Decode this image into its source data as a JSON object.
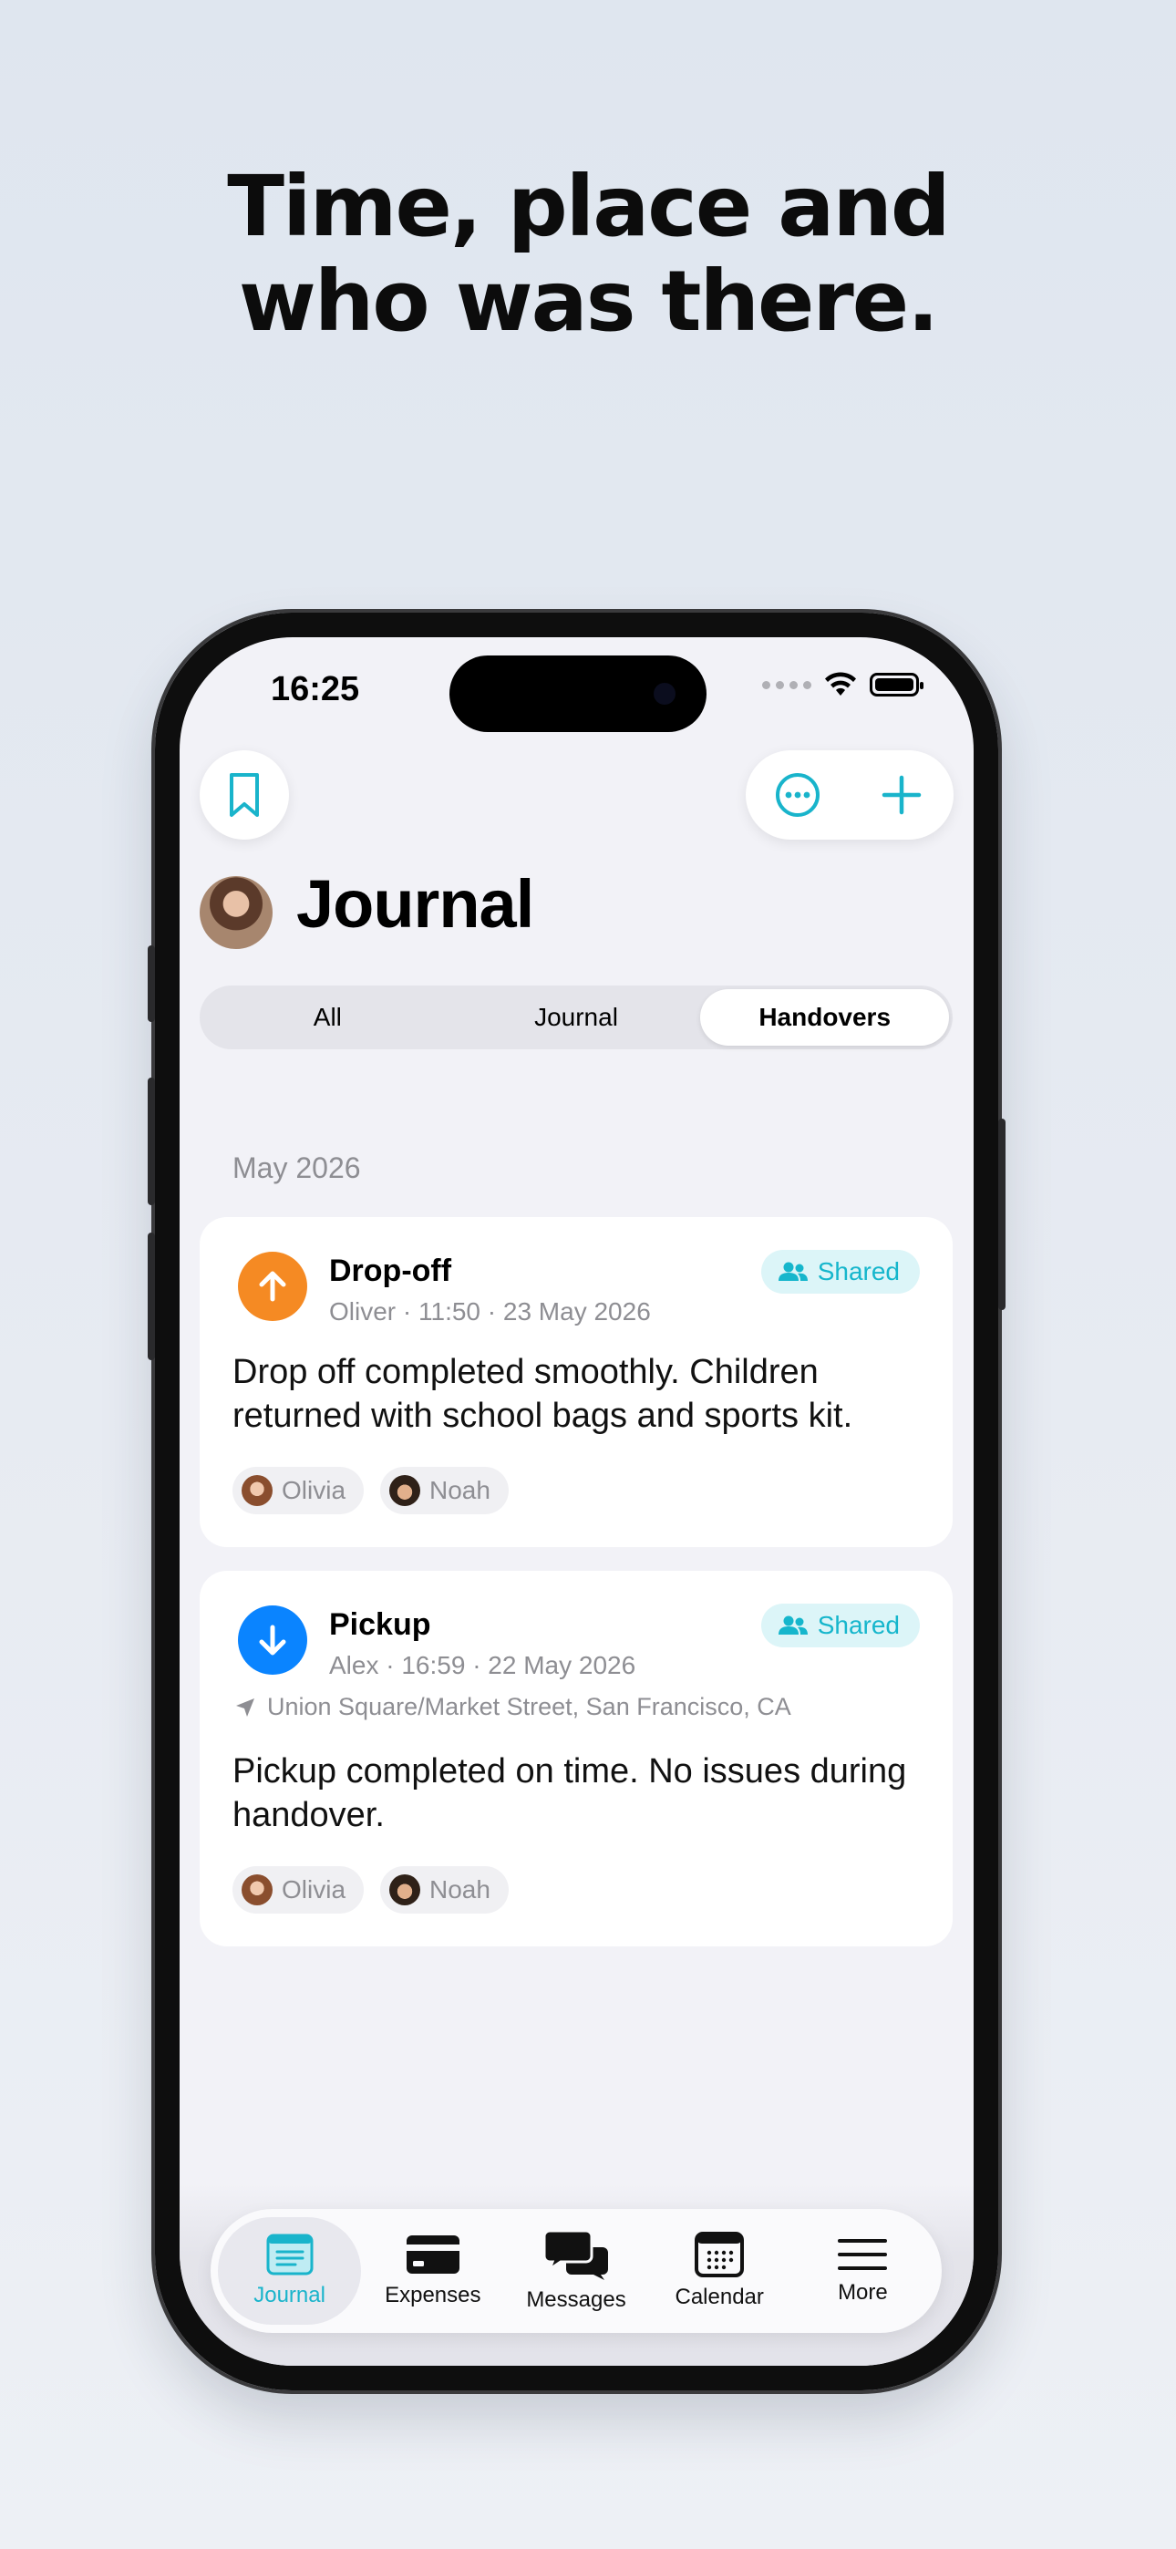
{
  "headline": {
    "line1": "Time, place and",
    "line2": "who was there."
  },
  "status_bar": {
    "time": "16:25"
  },
  "header": {
    "title": "Journal"
  },
  "segmented": {
    "options": [
      "All",
      "Journal",
      "Handovers"
    ],
    "selected": "Handovers"
  },
  "section": {
    "label": "May 2026"
  },
  "entries": [
    {
      "type": "Drop-off",
      "meta": "Oliver · 11:50 · 23 May 2026",
      "badge": "Shared",
      "location": "",
      "body": "Drop off completed smoothly. Children returned with school bags and sports kit.",
      "people": [
        "Olivia",
        "Noah"
      ],
      "color": "#f58a23"
    },
    {
      "type": "Pickup",
      "meta": "Alex · 16:59 · 22 May 2026",
      "badge": "Shared",
      "location": "Union Square/Market Street, San Francisco, CA",
      "body": "Pickup completed on time. No issues during handover.",
      "people": [
        "Olivia",
        "Noah"
      ],
      "color": "#0a84ff"
    }
  ],
  "tabbar": {
    "items": [
      {
        "label": "Journal",
        "icon": "journal-icon",
        "active": true
      },
      {
        "label": "Expenses",
        "icon": "card-icon",
        "active": false
      },
      {
        "label": "Messages",
        "icon": "chat-bubbles-icon",
        "active": false
      },
      {
        "label": "Calendar",
        "icon": "calendar-icon",
        "active": false
      },
      {
        "label": "More",
        "icon": "menu-icon",
        "active": false
      }
    ]
  },
  "colors": {
    "accent": "#19b4cb",
    "dropoff": "#f58a23",
    "pickup": "#0a84ff"
  }
}
